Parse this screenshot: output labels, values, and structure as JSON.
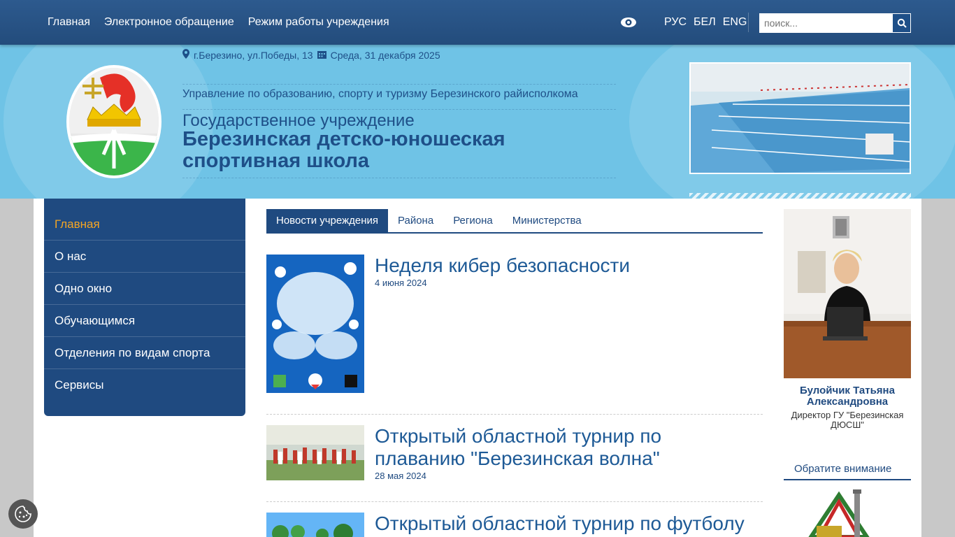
{
  "topnav": [
    "Главная",
    "Электронное обращение",
    "Режим работы учреждения"
  ],
  "langs": [
    "РУС",
    "БЕЛ",
    "ENG"
  ],
  "search": {
    "placeholder": "поиск..."
  },
  "header": {
    "address": "г.Березино, ул.Победы, 13",
    "date": "Среда, 31 декабря 2025",
    "dept": "Управление по образованию, спорту и туризму Березинского райисполкома",
    "gov": "Государственное учреждение",
    "school": "Березинская детско-юношеская спортивная школа"
  },
  "sidebar": {
    "items": [
      {
        "label": "Главная",
        "active": true
      },
      {
        "label": "О нас"
      },
      {
        "label": "Одно окно"
      },
      {
        "label": "Обучающимся"
      },
      {
        "label": "Отделения по видам спорта"
      },
      {
        "label": "Сервисы"
      }
    ]
  },
  "tabs": [
    {
      "label": "Новости учреждения",
      "active": true
    },
    {
      "label": "Района"
    },
    {
      "label": "Региона"
    },
    {
      "label": "Министерства"
    }
  ],
  "news": [
    {
      "title": "Неделя кибер безопасности",
      "date": "4 июня 2024"
    },
    {
      "title": "Открытый областной турнир по плаванию \"Березинская волна\"",
      "date": "28 мая 2024"
    },
    {
      "title": "Открытый областной турнир по футболу",
      "date": ""
    }
  ],
  "director": {
    "name": "Булойчик Татьяна Александровна",
    "role": "Директор ГУ \"Березинская ДЮСШ\""
  },
  "attention": "Обратите внимание",
  "colors": {
    "primary": "#1f4a80",
    "header_bg": "#6fc3e6",
    "active_menu": "#f5a623"
  }
}
